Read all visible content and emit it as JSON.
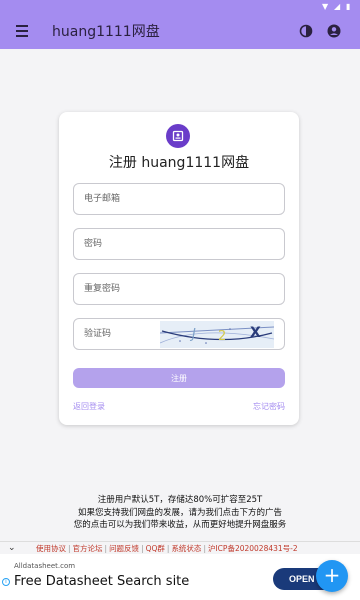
{
  "appbar": {
    "title": "huang1111网盘",
    "menu_icon": "hamburger-menu-icon",
    "theme_icon": "theme-toggle-icon",
    "account_icon": "account-circle-icon"
  },
  "card": {
    "title": "注册 huang1111网盘",
    "email_placeholder": "电子邮箱",
    "password_placeholder": "密码",
    "repeat_password_placeholder": "重复密码",
    "captcha_placeholder": "验证码",
    "register_label": "注册",
    "back_login_label": "返回登录",
    "forgot_password_label": "忘记密码"
  },
  "notice": {
    "line1": "注册用户默认5T，存储达80%可扩容至25T",
    "line2": "如果您支持我们网盘的发展，请为我们点击下方的广告",
    "line3": "您的点击可以为我们带来收益，从而更好地提升网盘服务"
  },
  "footer": {
    "links": [
      "使用协议",
      "官方论坛",
      "问题反馈",
      "QQ群",
      "系统状态",
      "沪ICP备2020028431号-2"
    ]
  },
  "ad": {
    "domain": "Alldatasheet.com",
    "headline": "Free Datasheet Search site",
    "open_label": "OPEN"
  },
  "colors": {
    "appbar": "#a48cf0",
    "accent": "#6a3cc9",
    "button": "#b4a2ec",
    "fab": "#2196f3"
  }
}
